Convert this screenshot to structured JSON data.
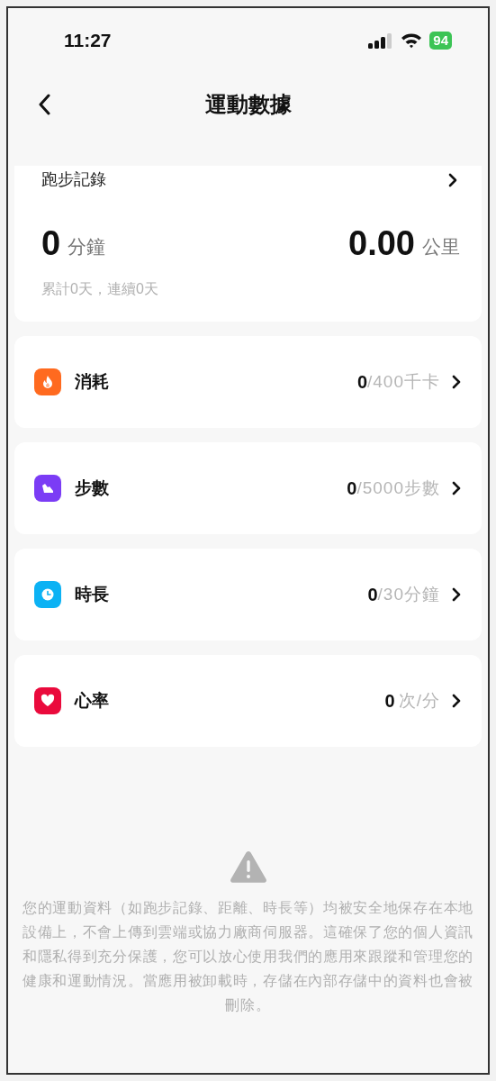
{
  "status_bar": {
    "time": "11:27",
    "battery": "94"
  },
  "header": {
    "title": "運動數據"
  },
  "running": {
    "title": "跑步記錄",
    "minutes": "0",
    "minutes_unit": "分鐘",
    "distance": "0.00",
    "distance_unit": "公里",
    "summary": "累計0天，連續0天"
  },
  "metrics": [
    {
      "kind": "flame",
      "color": "#ff6a1f",
      "label": "消耗",
      "value": "0",
      "goal": "/400千卡"
    },
    {
      "kind": "shoe",
      "color": "#7b3cf5",
      "label": "步數",
      "value": "0",
      "goal": "/5000步數"
    },
    {
      "kind": "clock",
      "color": "#0cb2f4",
      "label": "時長",
      "value": "0",
      "goal": "/30分鐘"
    },
    {
      "kind": "heart",
      "color": "#ea0a3c",
      "label": "心率",
      "value": "0",
      "goal": "次/分"
    }
  ],
  "notice": "您的運動資料（如跑步記錄、距離、時長等）均被安全地保存在本地設備上，不會上傳到雲端或協力廠商伺服器。這確保了您的個人資訊和隱私得到充分保護，您可以放心使用我們的應用來跟蹤和管理您的健康和運動情況。當應用被卸載時，存儲在內部存儲中的資料也會被刪除。"
}
